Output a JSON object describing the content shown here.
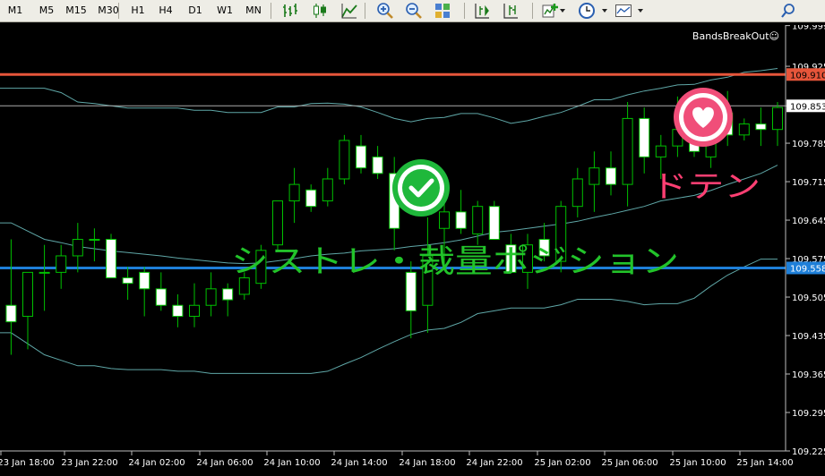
{
  "toolbar": {
    "timeframes": [
      "M1",
      "M5",
      "M15",
      "M30",
      "H1",
      "H4",
      "D1",
      "W1",
      "MN"
    ],
    "icons": [
      "bar-chart-icon",
      "candlestick-icon",
      "line-chart-icon",
      "zoom-in-icon",
      "zoom-out-icon",
      "tile-windows-icon",
      "chart-shift-icon",
      "autoscroll-icon",
      "new-indicator-icon",
      "periods-clock-icon",
      "templates-icon",
      "search-icon"
    ]
  },
  "chart": {
    "indicator_label": "BandsBreakOut☺",
    "price_axis": [
      "109.999",
      "109.925",
      "109.853",
      "109.785",
      "109.715",
      "109.645",
      "109.575",
      "109.505",
      "109.435",
      "109.365",
      "109.295",
      "109.225"
    ],
    "time_axis": [
      "23 Jan 18:00",
      "23 Jan 22:00",
      "24 Jan 02:00",
      "24 Jan 06:00",
      "24 Jan 10:00",
      "24 Jan 14:00",
      "24 Jan 18:00",
      "24 Jan 22:00",
      "25 Jan 02:00",
      "25 Jan 06:00",
      "25 Jan 10:00",
      "25 Jan 14:00"
    ],
    "red_line_price": "109.910",
    "grey_line_price": "109.853",
    "blue_line_price": "109.558",
    "annotation_main": "シストレ・裁量ポジション",
    "annotation_doten": "ドテン",
    "colors": {
      "background": "#000000",
      "bull": "#000000",
      "bear": "#ffffff",
      "wick": "#00c000",
      "bands": "#5fa7a7",
      "red_line": "#e6553a",
      "blue_line": "#1e7fd8",
      "green_text": "#22c32a",
      "pink_text": "#ff3f73",
      "check_icon": "#1fb83b",
      "heart_icon": "#f04e79"
    }
  },
  "chart_data": {
    "type": "candlestick",
    "ylim": [
      109.225,
      110.0
    ],
    "candles": [
      {
        "o": 109.49,
        "h": 109.61,
        "l": 109.4,
        "c": 109.46
      },
      {
        "o": 109.47,
        "h": 109.55,
        "l": 109.41,
        "c": 109.55
      },
      {
        "o": 109.55,
        "h": 109.6,
        "l": 109.48,
        "c": 109.55
      },
      {
        "o": 109.55,
        "h": 109.6,
        "l": 109.52,
        "c": 109.58
      },
      {
        "o": 109.58,
        "h": 109.64,
        "l": 109.55,
        "c": 109.61
      },
      {
        "o": 109.61,
        "h": 109.63,
        "l": 109.57,
        "c": 109.61
      },
      {
        "o": 109.61,
        "h": 109.62,
        "l": 109.55,
        "c": 109.54
      },
      {
        "o": 109.54,
        "h": 109.56,
        "l": 109.5,
        "c": 109.53
      },
      {
        "o": 109.55,
        "h": 109.56,
        "l": 109.47,
        "c": 109.52
      },
      {
        "o": 109.52,
        "h": 109.55,
        "l": 109.48,
        "c": 109.49
      },
      {
        "o": 109.49,
        "h": 109.51,
        "l": 109.45,
        "c": 109.47
      },
      {
        "o": 109.47,
        "h": 109.53,
        "l": 109.45,
        "c": 109.49
      },
      {
        "o": 109.49,
        "h": 109.55,
        "l": 109.47,
        "c": 109.52
      },
      {
        "o": 109.52,
        "h": 109.53,
        "l": 109.47,
        "c": 109.5
      },
      {
        "o": 109.51,
        "h": 109.55,
        "l": 109.5,
        "c": 109.54
      },
      {
        "o": 109.53,
        "h": 109.6,
        "l": 109.52,
        "c": 109.59
      },
      {
        "o": 109.6,
        "h": 109.68,
        "l": 109.59,
        "c": 109.68
      },
      {
        "o": 109.68,
        "h": 109.74,
        "l": 109.64,
        "c": 109.71
      },
      {
        "o": 109.7,
        "h": 109.71,
        "l": 109.66,
        "c": 109.67
      },
      {
        "o": 109.68,
        "h": 109.74,
        "l": 109.67,
        "c": 109.72
      },
      {
        "o": 109.72,
        "h": 109.8,
        "l": 109.71,
        "c": 109.79
      },
      {
        "o": 109.78,
        "h": 109.8,
        "l": 109.73,
        "c": 109.74
      },
      {
        "o": 109.76,
        "h": 109.78,
        "l": 109.72,
        "c": 109.73
      },
      {
        "o": 109.73,
        "h": 109.76,
        "l": 109.59,
        "c": 109.63
      },
      {
        "o": 109.55,
        "h": 109.57,
        "l": 109.43,
        "c": 109.48
      },
      {
        "o": 109.49,
        "h": 109.65,
        "l": 109.44,
        "c": 109.58
      },
      {
        "o": 109.63,
        "h": 109.71,
        "l": 109.56,
        "c": 109.66
      },
      {
        "o": 109.66,
        "h": 109.7,
        "l": 109.62,
        "c": 109.63
      },
      {
        "o": 109.62,
        "h": 109.68,
        "l": 109.6,
        "c": 109.67
      },
      {
        "o": 109.67,
        "h": 109.68,
        "l": 109.61,
        "c": 109.61
      },
      {
        "o": 109.6,
        "h": 109.62,
        "l": 109.55,
        "c": 109.55
      },
      {
        "o": 109.55,
        "h": 109.62,
        "l": 109.52,
        "c": 109.6
      },
      {
        "o": 109.61,
        "h": 109.64,
        "l": 109.57,
        "c": 109.58
      },
      {
        "o": 109.57,
        "h": 109.68,
        "l": 109.55,
        "c": 109.67
      },
      {
        "o": 109.67,
        "h": 109.74,
        "l": 109.65,
        "c": 109.72
      },
      {
        "o": 109.71,
        "h": 109.77,
        "l": 109.66,
        "c": 109.74
      },
      {
        "o": 109.74,
        "h": 109.77,
        "l": 109.69,
        "c": 109.71
      },
      {
        "o": 109.71,
        "h": 109.86,
        "l": 109.67,
        "c": 109.83
      },
      {
        "o": 109.83,
        "h": 109.85,
        "l": 109.73,
        "c": 109.76
      },
      {
        "o": 109.76,
        "h": 109.8,
        "l": 109.72,
        "c": 109.78
      },
      {
        "o": 109.78,
        "h": 109.87,
        "l": 109.76,
        "c": 109.81
      },
      {
        "o": 109.81,
        "h": 109.84,
        "l": 109.76,
        "c": 109.77
      },
      {
        "o": 109.76,
        "h": 109.87,
        "l": 109.74,
        "c": 109.84
      },
      {
        "o": 109.84,
        "h": 109.88,
        "l": 109.78,
        "c": 109.8
      },
      {
        "o": 109.8,
        "h": 109.83,
        "l": 109.79,
        "c": 109.82
      },
      {
        "o": 109.82,
        "h": 109.85,
        "l": 109.78,
        "c": 109.81
      },
      {
        "o": 109.81,
        "h": 109.86,
        "l": 109.78,
        "c": 109.85
      }
    ],
    "upper_band": [
      109.885,
      109.885,
      109.885,
      109.877,
      109.86,
      109.857,
      109.853,
      109.849,
      109.849,
      109.849,
      109.849,
      109.845,
      109.845,
      109.841,
      109.841,
      109.841,
      109.851,
      109.851,
      109.857,
      109.858,
      109.856,
      109.851,
      109.841,
      109.83,
      109.824,
      109.83,
      109.832,
      109.839,
      109.839,
      109.831,
      109.821,
      109.826,
      109.834,
      109.841,
      109.852,
      109.864,
      109.864,
      109.873,
      109.88,
      109.885,
      109.891,
      109.892,
      109.9,
      109.905,
      109.914,
      109.917,
      109.921
    ],
    "lower_band": [
      109.44,
      109.42,
      109.4,
      109.39,
      109.38,
      109.38,
      109.375,
      109.373,
      109.373,
      109.373,
      109.37,
      109.37,
      109.366,
      109.366,
      109.366,
      109.366,
      109.366,
      109.366,
      109.366,
      109.37,
      109.383,
      109.395,
      109.41,
      109.424,
      109.437,
      109.445,
      109.448,
      109.459,
      109.475,
      109.48,
      109.485,
      109.485,
      109.485,
      109.491,
      109.501,
      109.501,
      109.501,
      109.497,
      109.491,
      109.493,
      109.493,
      109.503,
      109.525,
      109.545,
      109.56,
      109.574,
      109.574
    ],
    "middle_band": [
      109.64,
      109.625,
      109.61,
      109.604,
      109.597,
      109.593,
      109.589,
      109.586,
      109.583,
      109.58,
      109.576,
      109.573,
      109.57,
      109.567,
      109.566,
      109.567,
      109.571,
      109.575,
      109.58,
      109.583,
      109.585,
      109.589,
      109.591,
      109.593,
      109.597,
      109.6,
      109.604,
      109.609,
      109.616,
      109.623,
      109.626,
      109.63,
      109.634,
      109.638,
      109.643,
      109.65,
      109.656,
      109.663,
      109.67,
      109.68,
      109.685,
      109.69,
      109.699,
      109.71,
      109.72,
      109.73,
      109.745
    ]
  }
}
